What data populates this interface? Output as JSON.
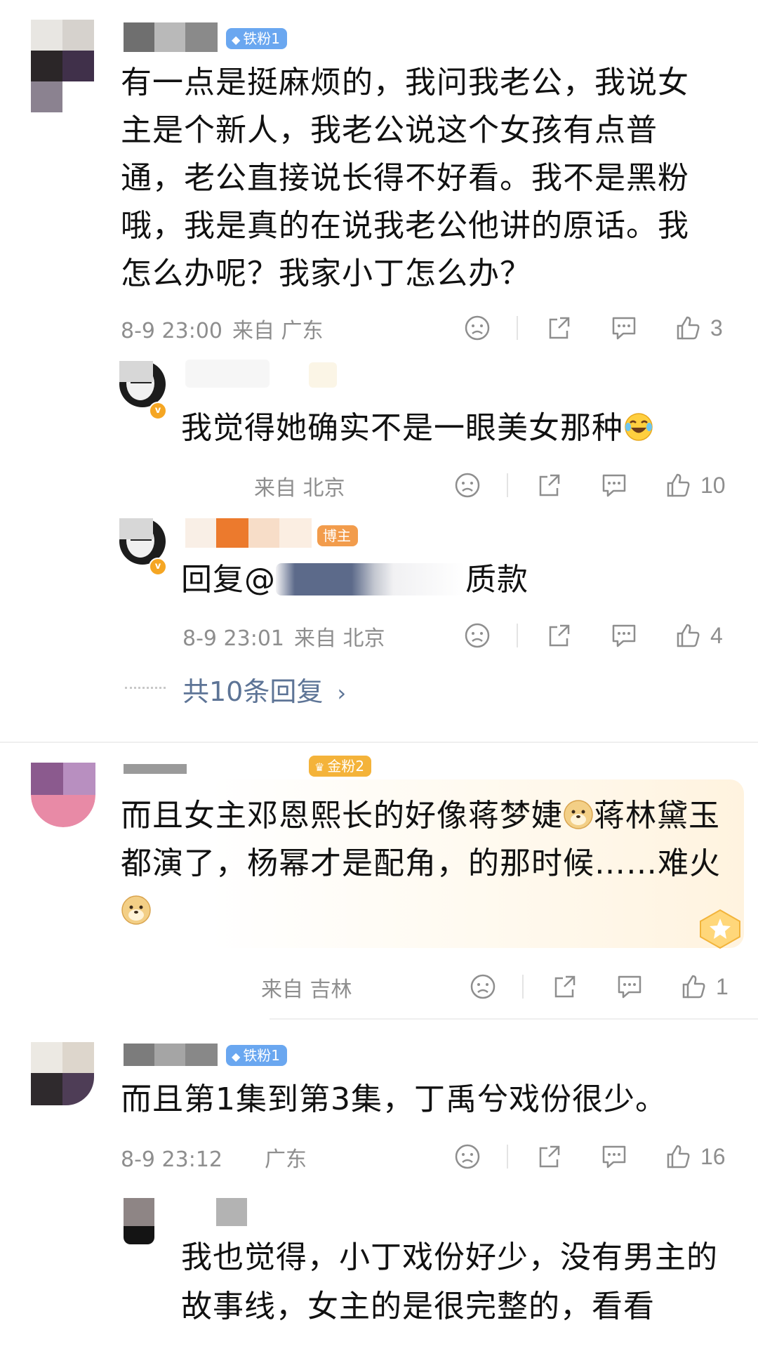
{
  "colors": {
    "text": "#111111",
    "meta": "#8e8e8e",
    "badge_iron": "#6aa7f0",
    "badge_gold": "#f4b33a",
    "divider": "#efefef"
  },
  "comments": [
    {
      "badge": "铁粉1",
      "text": "有一点是挺麻烦的，我问我老公，我说女主是个新人，我老公说这个女孩有点普通，老公直接说长得不好看。我不是黑粉哦，我是真的在说我老公他讲的原话。我怎么办呢？我家小丁怎么办？",
      "time": "8-9 23:00",
      "location": "来自 广东",
      "likes": "3",
      "replies": [
        {
          "text": "我觉得她确实不是一眼美女那种",
          "emoji": "laugh-cry",
          "time": "",
          "location": "来自 北京",
          "likes": "10"
        },
        {
          "badge": "博主",
          "text_prefix": "回复@",
          "text_suffix": "质款",
          "time": "8-9 23:01",
          "location": "来自 北京",
          "likes": "4"
        }
      ],
      "more_replies": "共10条回复"
    },
    {
      "badge": "金粉2",
      "text_a": "而且女主邓恩熙长的好像蒋梦婕",
      "text_b": "蒋林黛玉都演了，杨幂才是配角，的那时候……难火",
      "time": "",
      "location": "来自 吉林",
      "likes": "1"
    },
    {
      "badge": "铁粉1",
      "text": "而且第1集到第3集，丁禹兮戏份很少。",
      "time": "8-9 23:12",
      "location": "广东",
      "likes": "16",
      "replies": [
        {
          "text": "我也觉得，小丁戏份好少，没有男主的故事线，女主的是很完整的，看看"
        }
      ]
    }
  ]
}
